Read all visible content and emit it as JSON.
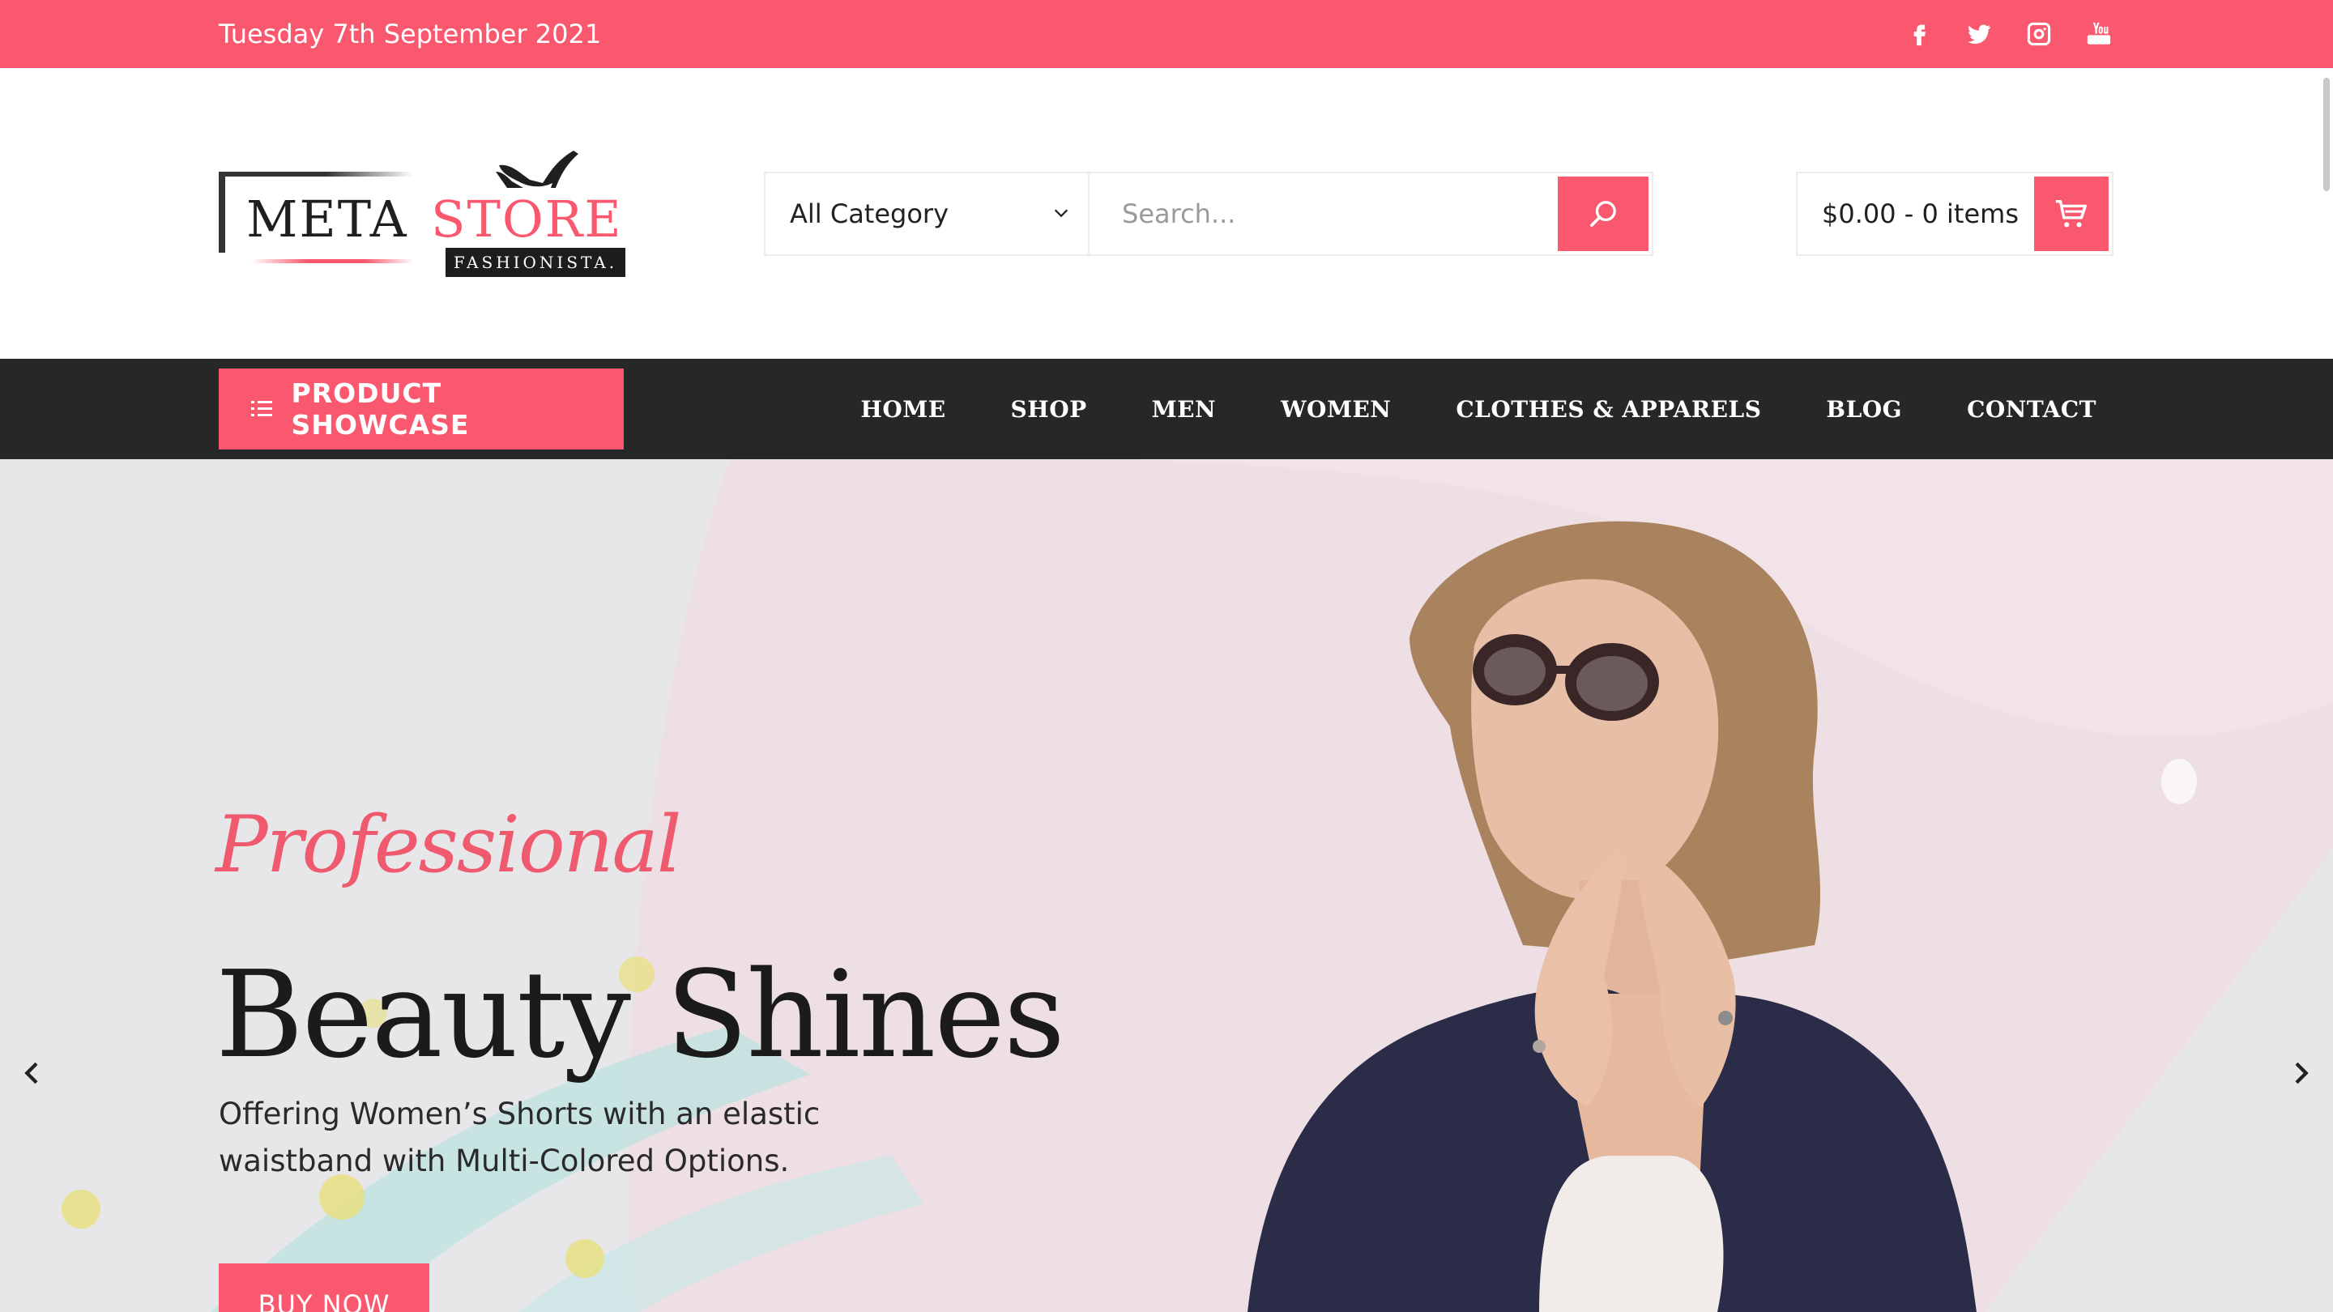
{
  "topbar": {
    "date": "Tuesday 7th September 2021",
    "social": [
      {
        "name": "facebook-icon"
      },
      {
        "name": "twitter-icon"
      },
      {
        "name": "instagram-icon"
      },
      {
        "name": "youtube-icon"
      }
    ]
  },
  "logo": {
    "word1": "META",
    "word2": "STORE",
    "tagline": "FASHIONISTA."
  },
  "search": {
    "category": "All Category",
    "placeholder": "Search..."
  },
  "cart": {
    "summary": "$0.00 - 0 items"
  },
  "nav": {
    "showcase_label": "PRODUCT SHOWCASE",
    "items": [
      "HOME",
      "SHOP",
      "MEN",
      "WOMEN",
      "CLOTHES & APPARELS",
      "BLOG",
      "CONTACT"
    ]
  },
  "hero": {
    "script": "Professional",
    "headline": "Beauty Shines",
    "subtext": "Offering Women’s Shorts with an elastic waistband with Multi-Colored Options.",
    "button": "BUY NOW"
  },
  "colors": {
    "accent": "#f9586e",
    "nav_bg": "#272727",
    "hero_bg": "#e7e7ea"
  }
}
